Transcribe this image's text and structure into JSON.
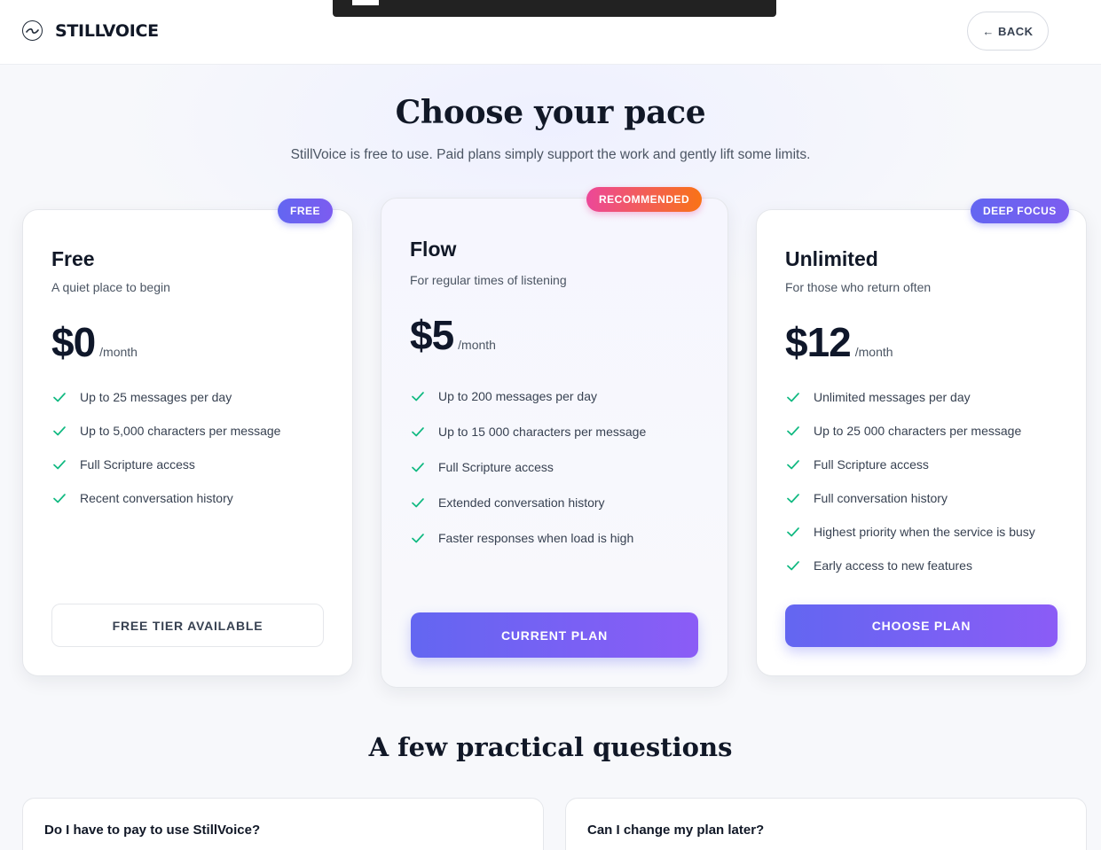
{
  "header": {
    "brand": "STILLVOICE",
    "back_label": "← BACK"
  },
  "hero": {
    "title": "Choose your pace",
    "subtitle": "StillVoice is free to use. Paid plans simply support the work and gently lift some limits."
  },
  "plans": [
    {
      "badge": "FREE",
      "name": "Free",
      "description": "A quiet place to begin",
      "price": "$0",
      "period": "/month",
      "features": [
        "Up to 25 messages per day",
        "Up to 5,000 characters per message",
        "Full Scripture access",
        "Recent conversation history"
      ],
      "cta": "FREE TIER AVAILABLE"
    },
    {
      "badge": "RECOMMENDED",
      "name": "Flow",
      "description": "For regular times of listening",
      "price": "$5",
      "period": "/month",
      "features": [
        "Up to 200 messages per day",
        "Up to 15 000 characters per message",
        "Full Scripture access",
        "Extended conversation history",
        "Faster responses when load is high"
      ],
      "cta": "CURRENT PLAN"
    },
    {
      "badge": "DEEP FOCUS",
      "name": "Unlimited",
      "description": "For those who return often",
      "price": "$12",
      "period": "/month",
      "features": [
        "Unlimited messages per day",
        "Up to 25 000 characters per message",
        "Full Scripture access",
        "Full conversation history",
        "Highest priority when the service is busy",
        "Early access to new features"
      ],
      "cta": "CHOOSE PLAN"
    }
  ],
  "faq": {
    "title": "A few practical questions",
    "questions": [
      "Do I have to pay to use StillVoice?",
      "Can I change my plan later?"
    ]
  },
  "colors": {
    "accent": "#6366f1",
    "accent_end": "#8b5cf6",
    "recommended_start": "#ec4899",
    "recommended_end": "#f97316",
    "check": "#10b981"
  }
}
